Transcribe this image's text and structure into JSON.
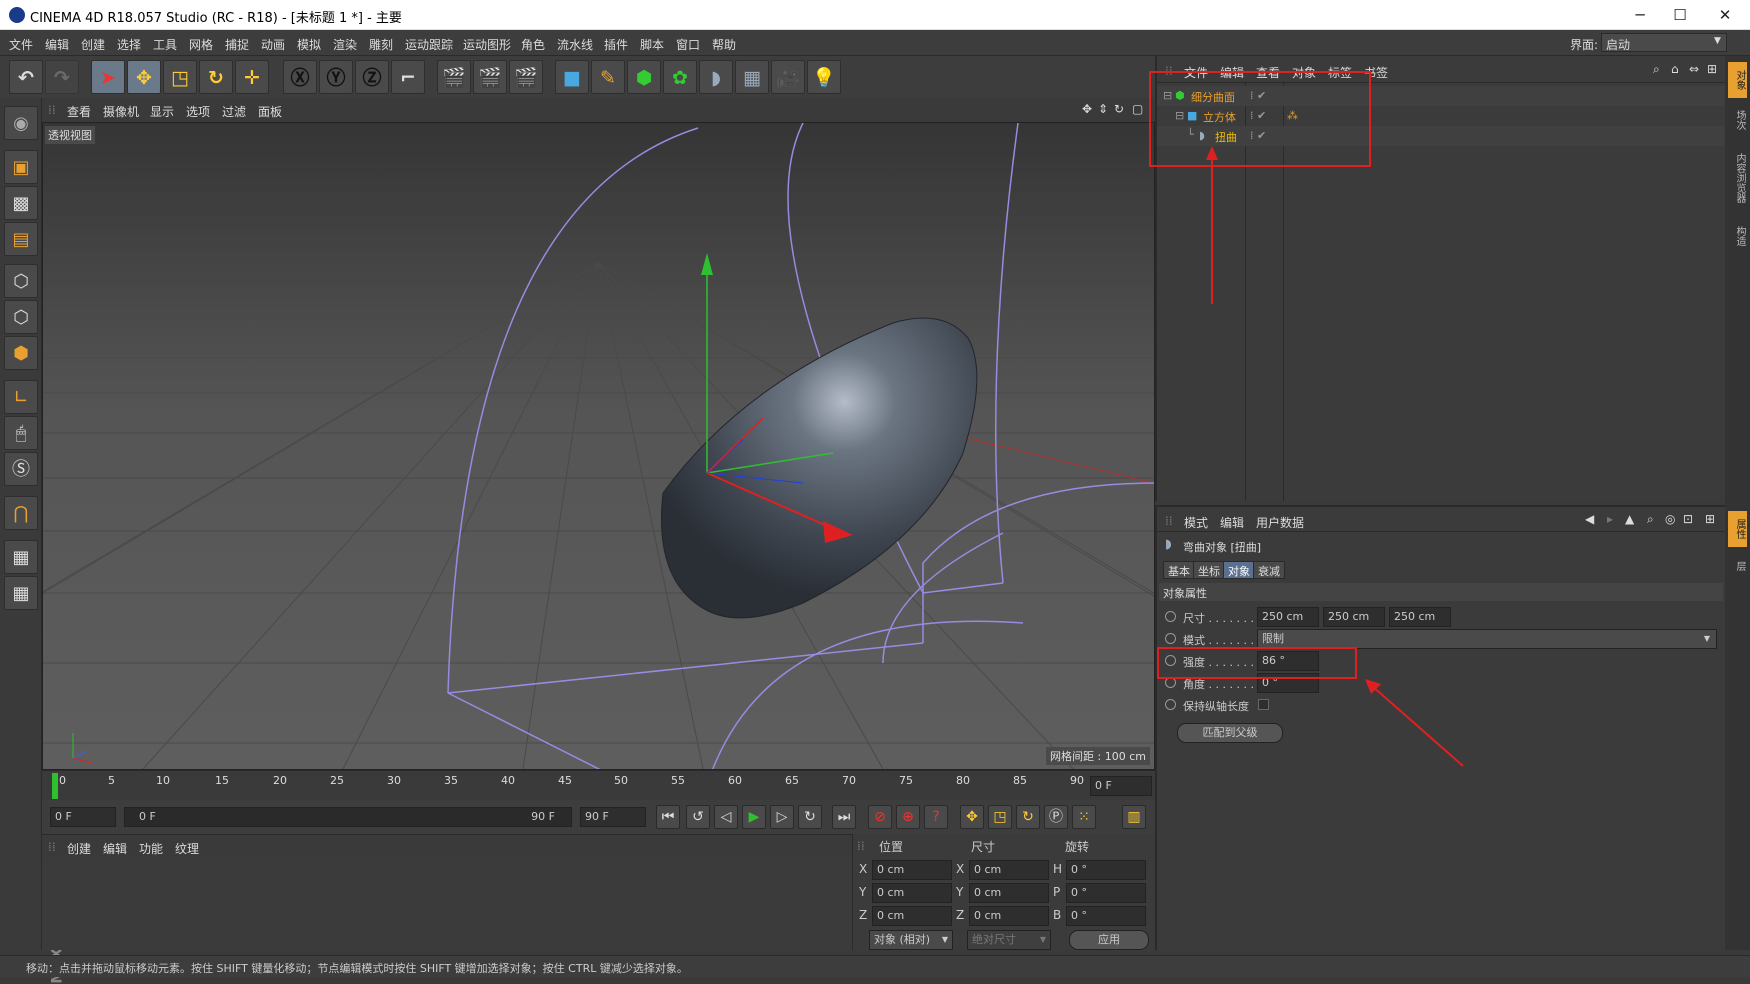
{
  "window": {
    "title": "CINEMA 4D R18.057 Studio (RC - R18) - [未标题 1 *] - 主要",
    "minimize": "─",
    "maximize": "☐",
    "close": "✕"
  },
  "menu": [
    "文件",
    "编辑",
    "创建",
    "选择",
    "工具",
    "网格",
    "捕捉",
    "动画",
    "模拟",
    "渲染",
    "雕刻",
    "运动跟踪",
    "运动图形",
    "角色",
    "流水线",
    "插件",
    "脚本",
    "窗口",
    "帮助"
  ],
  "layout": {
    "label": "界面:",
    "value": "启动"
  },
  "viewport": {
    "menu": [
      "查看",
      "摄像机",
      "显示",
      "选项",
      "过滤",
      "面板"
    ],
    "label": "透视视图",
    "grid_note": "网格间距 : 100 cm"
  },
  "timeline": {
    "ticks": [
      "0",
      "5",
      "10",
      "15",
      "20",
      "25",
      "30",
      "35",
      "40",
      "45",
      "50",
      "55",
      "60",
      "65",
      "70",
      "75",
      "80",
      "85",
      "90"
    ],
    "current": "0 F"
  },
  "transport": {
    "start": "0 F",
    "range_start": "0 F",
    "range_end": "90 F",
    "end": "90 F"
  },
  "material": {
    "menu": [
      "创建",
      "编辑",
      "功能",
      "纹理"
    ]
  },
  "coords": {
    "headers": [
      "位置",
      "尺寸",
      "旋转"
    ],
    "rows": [
      {
        "axis": "X",
        "pos": "0 cm",
        "size": "0 cm",
        "rlabel": "H",
        "rot": "0 °"
      },
      {
        "axis": "Y",
        "pos": "0 cm",
        "size": "0 cm",
        "rlabel": "P",
        "rot": "0 °"
      },
      {
        "axis": "Z",
        "pos": "0 cm",
        "size": "0 cm",
        "rlabel": "B",
        "rot": "0 °"
      }
    ],
    "mode": "对象 (相对)",
    "size_mode": "绝对尺寸",
    "apply": "应用"
  },
  "status": "移动：点击并拖动鼠标移动元素。按住 SHIFT 键量化移动；节点编辑模式时按住 SHIFT 键增加选择对象；按住 CTRL 键减少选择对象。",
  "objects": {
    "menu": [
      "文件",
      "编辑",
      "查看",
      "对象",
      "标签",
      "书签"
    ],
    "items": [
      "细分曲面",
      "立方体",
      "扭曲"
    ]
  },
  "attributes": {
    "menu": [
      "模式",
      "编辑",
      "用户数据"
    ],
    "object_title": "弯曲对象 [扭曲]",
    "tabs": [
      "基本",
      "坐标",
      "对象",
      "衰减"
    ],
    "section": "对象属性",
    "size_label": "尺寸 . . . . . . .",
    "size": [
      "250 cm",
      "250 cm",
      "250 cm"
    ],
    "mode_label": "模式 . . . . . . .",
    "mode_value": "限制",
    "strength_label": "强度 . . . . . . .",
    "strength_value": "86 °",
    "angle_label": "角度 . . . . . . .",
    "angle_value": "0 °",
    "keep_label": "保持纵轴长度",
    "fit_button": "匹配到父级"
  },
  "side_tabs": [
    "对象",
    "场次",
    "内容浏览器",
    "构造"
  ],
  "side_tabs2": [
    "属性",
    "层"
  ],
  "colors": {
    "accent": "#5b6f8f",
    "annotation": "#e02020",
    "tree_item": "#e8a030"
  }
}
